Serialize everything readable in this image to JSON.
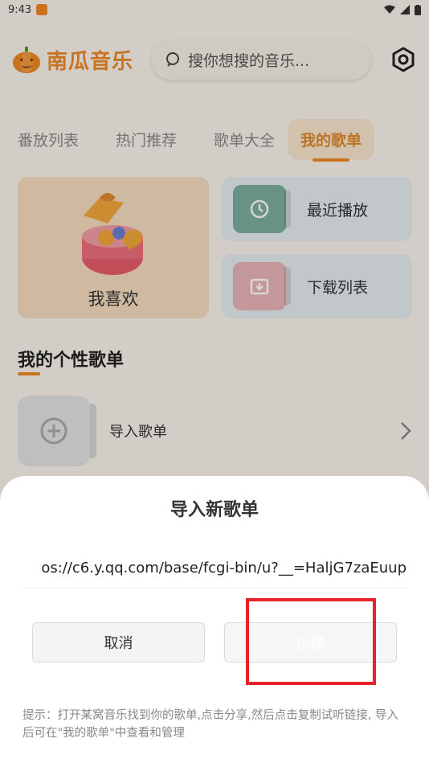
{
  "status_bar": {
    "time": "9:43"
  },
  "header": {
    "app_name": "南瓜音乐",
    "search_placeholder": "搜你想搜的音乐..."
  },
  "tabs": [
    {
      "label": "番放列表",
      "active": false
    },
    {
      "label": "热门推荐",
      "active": false
    },
    {
      "label": "歌单大全",
      "active": false
    },
    {
      "label": "我的歌单",
      "active": true
    }
  ],
  "cards": {
    "favorites": "我喜欢",
    "recent": "最近播放",
    "downloads": "下载列表"
  },
  "section": {
    "title": "我的个性歌单",
    "import_label": "导入歌单"
  },
  "dialog": {
    "title": "导入新歌单",
    "url_value": "os://c6.y.qq.com/base/fcgi-bin/u?__=HaljG7zaEuup",
    "cancel_label": "取消",
    "create_label": "创建",
    "hint": "提示：打开某窝音乐找到你的歌单,点击分享,然后点击复制试听链接, 导入后可在\"我的歌单\"中查看和管理"
  },
  "colors": {
    "accent": "#f08a24",
    "highlight": "#e8222b"
  }
}
